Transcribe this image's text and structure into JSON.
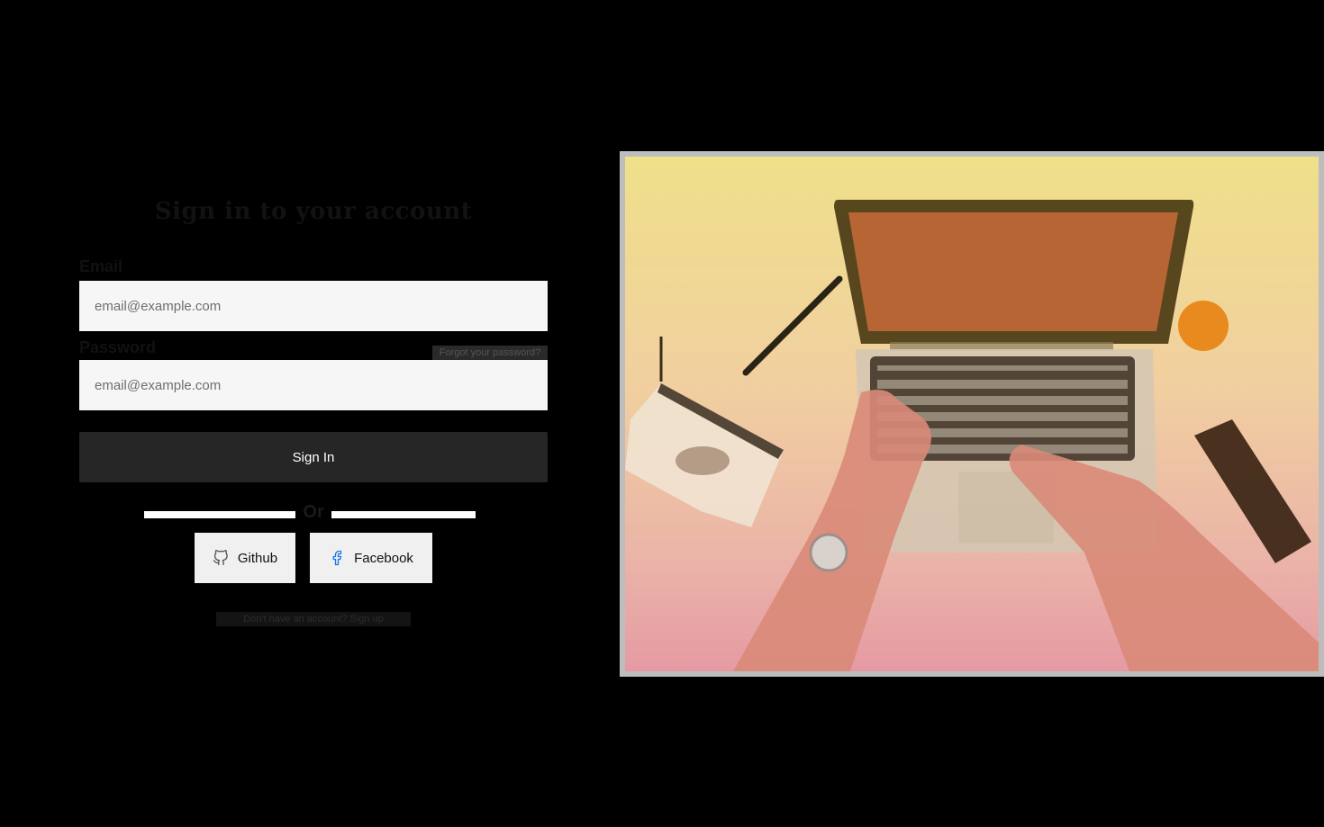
{
  "form": {
    "title": "Sign in to your account",
    "email_label": "Email",
    "email_placeholder": "email@example.com",
    "password_label": "Password",
    "password_placeholder": "email@example.com",
    "forgot_link": "Forgot your password?",
    "signin_label": "Sign In",
    "divider_text": "Or",
    "social": {
      "github_label": "Github",
      "github_icon": "github-icon",
      "facebook_label": "Facebook",
      "facebook_icon": "facebook-icon"
    },
    "signup_text": "Don't have an account? Sign up"
  },
  "colors": {
    "page_background": "#000000",
    "input_background": "#f6f6f6",
    "button_background": "#262626",
    "facebook_blue": "#1877f2"
  },
  "hero": {
    "image_icon": "laptop-desk-photo"
  }
}
